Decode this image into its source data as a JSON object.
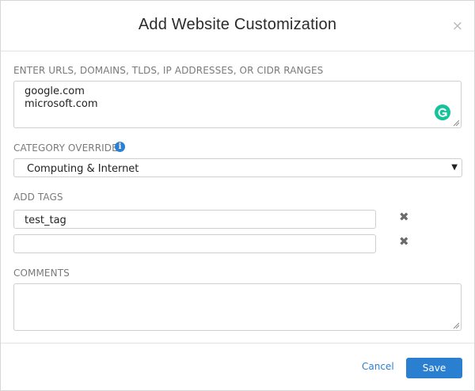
{
  "dialog": {
    "title": "Add Website Customization",
    "close_label": "×"
  },
  "urls": {
    "label": "ENTER URLS, DOMAINS, TLDS, IP ADDRESSES, OR CIDR RANGES",
    "lines": [
      "google.com",
      "microsoft.com"
    ]
  },
  "category": {
    "label": "CATEGORY OVERRIDE",
    "info_icon": "i",
    "selected": "Computing & Internet",
    "arrow": "▼"
  },
  "tags": {
    "label": "ADD TAGS",
    "rows": [
      {
        "value": "test_tag",
        "remove_label": "✖"
      },
      {
        "value": "",
        "remove_label": "✖"
      }
    ]
  },
  "comments": {
    "label": "COMMENTS",
    "value": ""
  },
  "footer": {
    "cancel_label": "Cancel",
    "save_label": "Save"
  },
  "colors": {
    "accent": "#2b7fd1",
    "grammarly": "#15c39a"
  }
}
